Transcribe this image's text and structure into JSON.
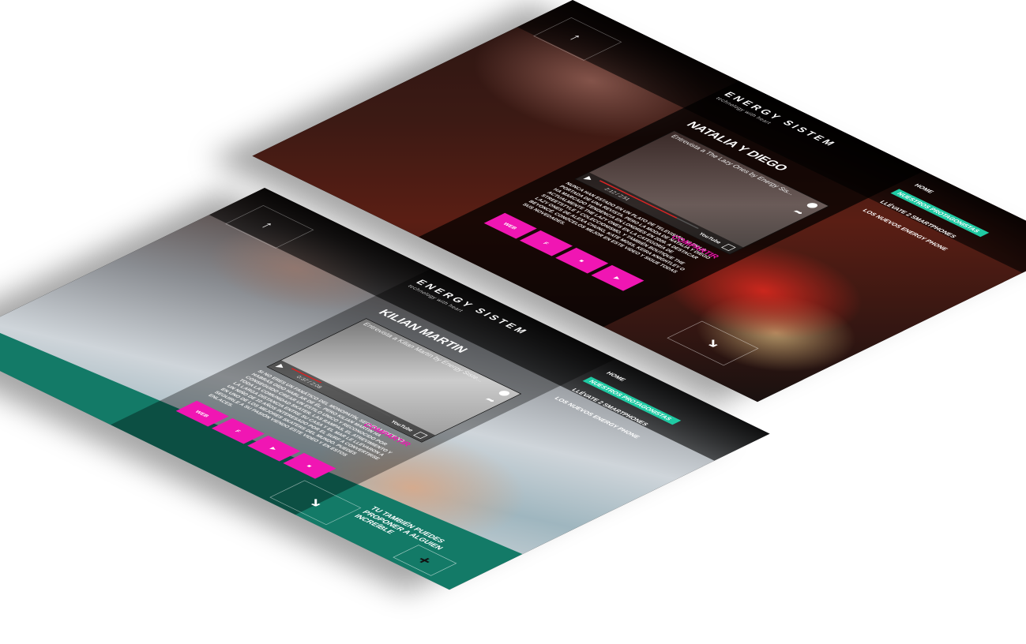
{
  "colors": {
    "accent_pink": "#f016b3",
    "accent_teal": "#1fcaa3",
    "deep_teal": "#137a67"
  },
  "icons": [
    "back-arrow-icon",
    "play-icon",
    "fullscreen-icon",
    "clock-icon",
    "share-icon",
    "forward-arrow-icon",
    "plus-icon"
  ],
  "back_screen": {
    "logo": "ENERGY SISTEM",
    "tagline": "technology with heart",
    "nav": [
      {
        "label": "HOME"
      },
      {
        "label": "NUESTROS PROTAGONISTAS",
        "active": true
      },
      {
        "label": "LLÉVATE 2 SMARTPHONES"
      },
      {
        "label": "LOS NUEVOS ENERGY PHONE"
      }
    ],
    "title": "NATALIA Y DIEGO",
    "video_title": "Entrevista a The Lazy Ones by Energy Sis...",
    "video_time": "2:12 / 2:51",
    "video_progress": 0.78,
    "youtube": "YouTube",
    "body": "NUNCA HAN ESTADO EN UN PLATO DE TELEVISIÓN, NI EN LA PORTADA DE UNA REVISTA. PERO LA MODA DE NATALIA Y DIEGO HA MARCADO TENDENCIA EN LONDRES EN 2009. A DESTACAR ACTUALMENTE THE LAZY ONES EN LA CATEGORÍA DE STREETSTYLE Y COLECCIONISMO. Y TAMBIÉN BOUTIQUE THE LAZY ONES DE ALEXA CHUNG, KATE MOSS, KEIRA KNIGHTLEY O BEYONCÉ. CONÓCELOS MEJOR EN ESTE VIDEO Y SIGUE TODAS SUS NOVEDADES.",
    "share": "COMPARTIR",
    "buttons": [
      "WEB",
      "f",
      "■",
      "▶"
    ]
  },
  "front_screen": {
    "logo": "ENERGY SISTEM",
    "tagline": "technology with heart",
    "nav": [
      {
        "label": "HOME"
      },
      {
        "label": "NUESTROS PROTAGONISTAS",
        "active": true
      },
      {
        "label": "LLÉVATE 2 SMARTPHONES"
      },
      {
        "label": "LOS NUEVOS ENERGY PHONE"
      }
    ],
    "title": "KILIAN MARTIN",
    "video_title": "Entrevista a Kilian Martin by Energy Siste...",
    "video_time": "0:37 / 2:08",
    "video_progress": 0.3,
    "youtube": "YouTube",
    "body": "SI NO ERES UN FANÁTICO DEL MONOPATÍN, SEGURAMENTE NO HABRÁS OÍDO HABLAR DE ÉL. PERO KILIAN MARTIN HA CONSEGUIDO CREAR UN ESTILO ÚNICO Y RECONOCIDO POR TODA LA COMUNIDAD SKATER. LAS RAMPAS, EL ATREVIMIENTO Y LA LARGA DISTANCIA ENTRE SU CASA Y EL MAR LE LLEVARON A UN NIÑO DE 10 AÑOS INTERESADO POR EL SURF A CONVERTIRSE EN UNO DE LOS MEJORES SKATERS DEL MUNDO. PUEDES SEGUIRLE A SU PASIÓN VIENDO ESTE VIDEO Y EN ESTOS ENLACES.",
    "share": "COMPARTIR",
    "buttons": [
      "WEB",
      "f",
      "▶",
      "■"
    ],
    "promo": "TU TAMBIÉN PUEDES PROPONER A ALGUIEN INCREÍBLE"
  }
}
